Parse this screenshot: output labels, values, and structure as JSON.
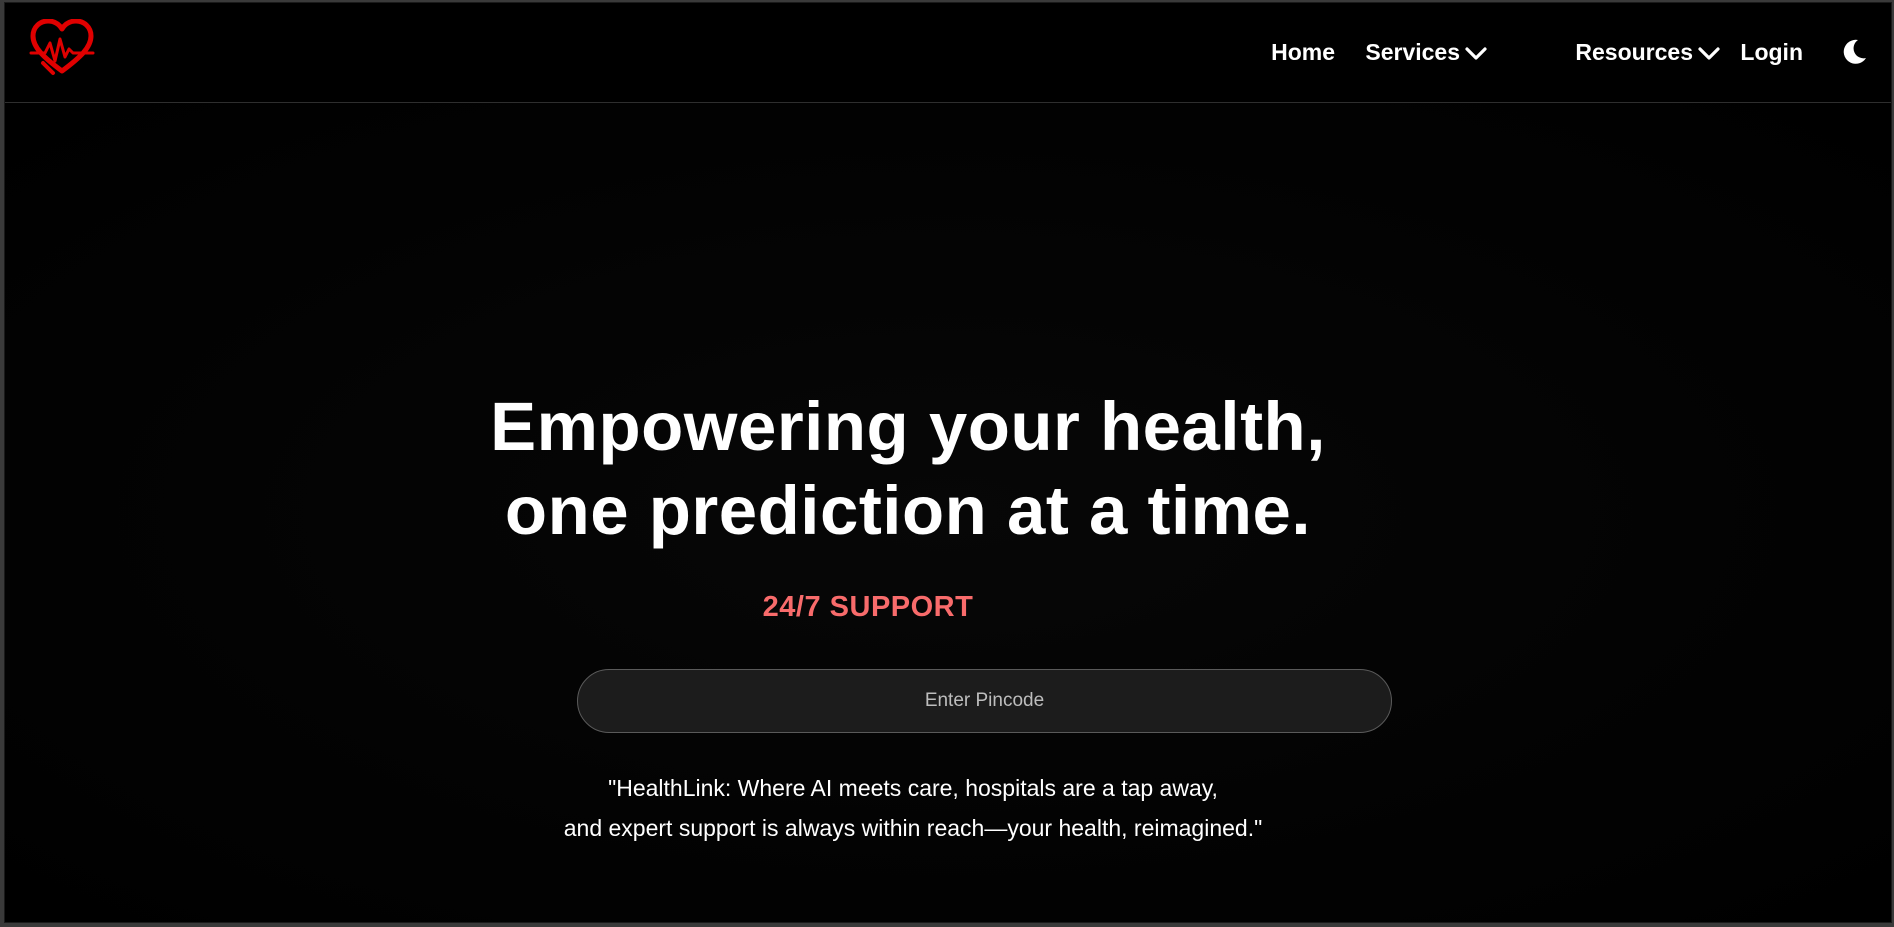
{
  "nav": {
    "links": [
      {
        "label": "Home"
      },
      {
        "label": "Services",
        "has_dropdown": true
      },
      {
        "label": "Resources",
        "has_dropdown": true
      },
      {
        "label": "Login"
      }
    ],
    "theme_toggle_icon": "moon-icon",
    "logo_icon": "heart-pulse-icon"
  },
  "hero": {
    "headline_line1": "Empowering your health,",
    "headline_line2": "one prediction at a time.",
    "support_label": "24/7 SUPPORT",
    "pincode_placeholder": "Enter Pincode",
    "quote_line1": "\"HealthLink: Where AI meets care, hospitals are a tap away,",
    "quote_line2": "and expert support is always within reach—your health, reimagined.\""
  },
  "colors": {
    "background": "#000000",
    "accent_red": "#e00000",
    "support_text": "#f86b6b",
    "input_bg": "#1c1c1c"
  }
}
